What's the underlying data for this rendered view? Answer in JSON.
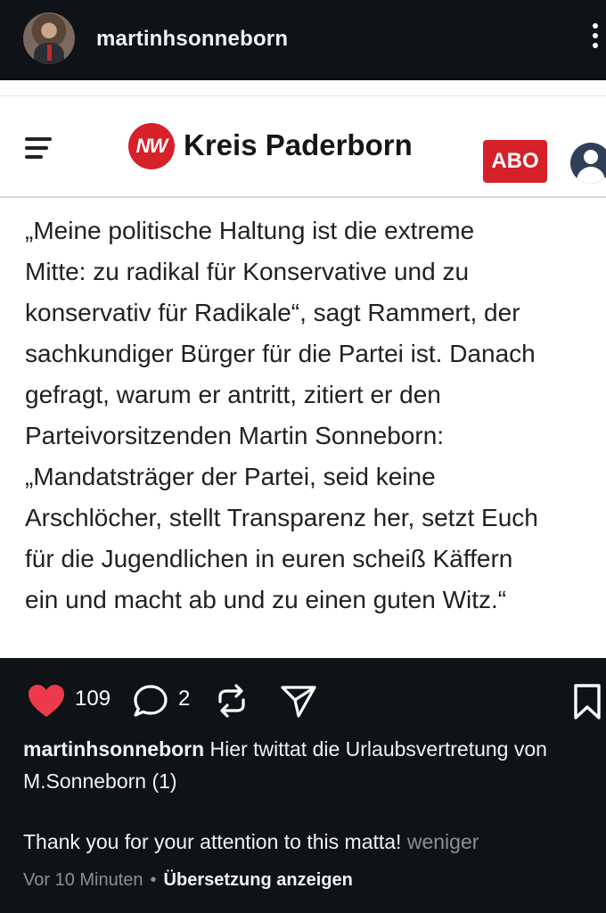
{
  "profile": {
    "username": "martinhsonneborn",
    "avatar_icon": "avatar",
    "more_icon": "more-vertical-icon"
  },
  "article": {
    "menu_icon": "hamburger-menu-icon",
    "logo_badge": "NW",
    "logo_title": "Kreis Paderborn",
    "abo_label": "ABO",
    "brand_color": "#d6202a",
    "body": "„Meine politische Haltung ist die extreme\nMitte: zu radikal für Konservative und zu\nkonservativ für Radikale“, sagt Rammert, der\nsachkundiger Bürger für die Partei ist. Danach\ngefragt, warum er antritt, zitiert er den\nParteivorsitzenden Martin Sonneborn:\n„Mandatsträger der Partei, seid keine\nArschlöcher, stellt Transparenz her, setzt Euch\nfür die Jugendlichen in euren scheiß Käffern\nein und macht ab und zu einen guten Witz.“"
  },
  "actions": {
    "likes": "109",
    "comments": "2",
    "like_color": "#ed3a4b"
  },
  "caption": {
    "user": "martinhsonneborn",
    "text": " Hier twittat die Urlaubsvertretung von M.Sonneborn (1)",
    "line2": "Thank you for your attention to this matta!",
    "less": " weniger"
  },
  "meta": {
    "time": "Vor 10 Minuten",
    "dot": "•",
    "translate": "Übersetzung anzeigen"
  }
}
